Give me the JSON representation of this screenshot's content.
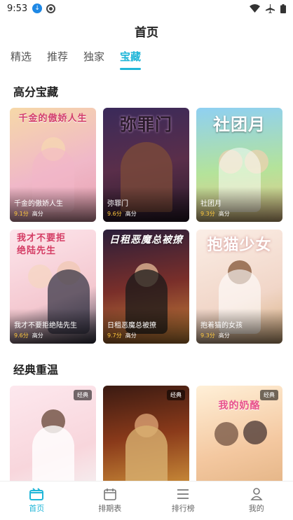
{
  "status": {
    "time": "9:53"
  },
  "header": {
    "title": "首页"
  },
  "tabs": [
    {
      "label": "精选",
      "active": false
    },
    {
      "label": "推荐",
      "active": false
    },
    {
      "label": "独家",
      "active": false
    },
    {
      "label": "宝藏",
      "active": true
    }
  ],
  "sections": [
    {
      "title": "高分宝藏",
      "cards": [
        {
          "cover_text": "千金的傲娇人生",
          "title": "千金的傲娇人生",
          "score": "9.1分",
          "tag": "高分"
        },
        {
          "cover_text": "弥罪门",
          "title": "弥罪门",
          "score": "9.6分",
          "tag": "高分"
        },
        {
          "cover_text": "社团月",
          "title": "社团月",
          "score": "9.3分",
          "tag": "高分"
        },
        {
          "cover_text": "我才不要拒绝陆先生",
          "title": "我才不要拒绝陆先生",
          "score": "9.6分",
          "tag": "高分"
        },
        {
          "cover_text": "日租恶魔总被撩",
          "title": "日租恶魔总被撩",
          "score": "9.7分",
          "tag": "高分"
        },
        {
          "cover_text": "抱猫少女",
          "title": "抱着猫的女孩",
          "score": "9.3分",
          "tag": "高分"
        }
      ]
    },
    {
      "title": "经典重温",
      "cards": [
        {
          "cover_text": "",
          "badge": "经典"
        },
        {
          "cover_text": "",
          "badge": "经典"
        },
        {
          "cover_text": "我的奶酪",
          "badge": "经典"
        }
      ]
    }
  ],
  "bottom_nav": [
    {
      "label": "首页",
      "icon": "home-icon",
      "active": true
    },
    {
      "label": "排期表",
      "icon": "calendar-icon",
      "active": false
    },
    {
      "label": "排行榜",
      "icon": "ranking-icon",
      "active": false
    },
    {
      "label": "我的",
      "icon": "profile-icon",
      "active": false
    }
  ],
  "colors": {
    "accent": "#20b6d8",
    "score": "#ffc83d"
  }
}
